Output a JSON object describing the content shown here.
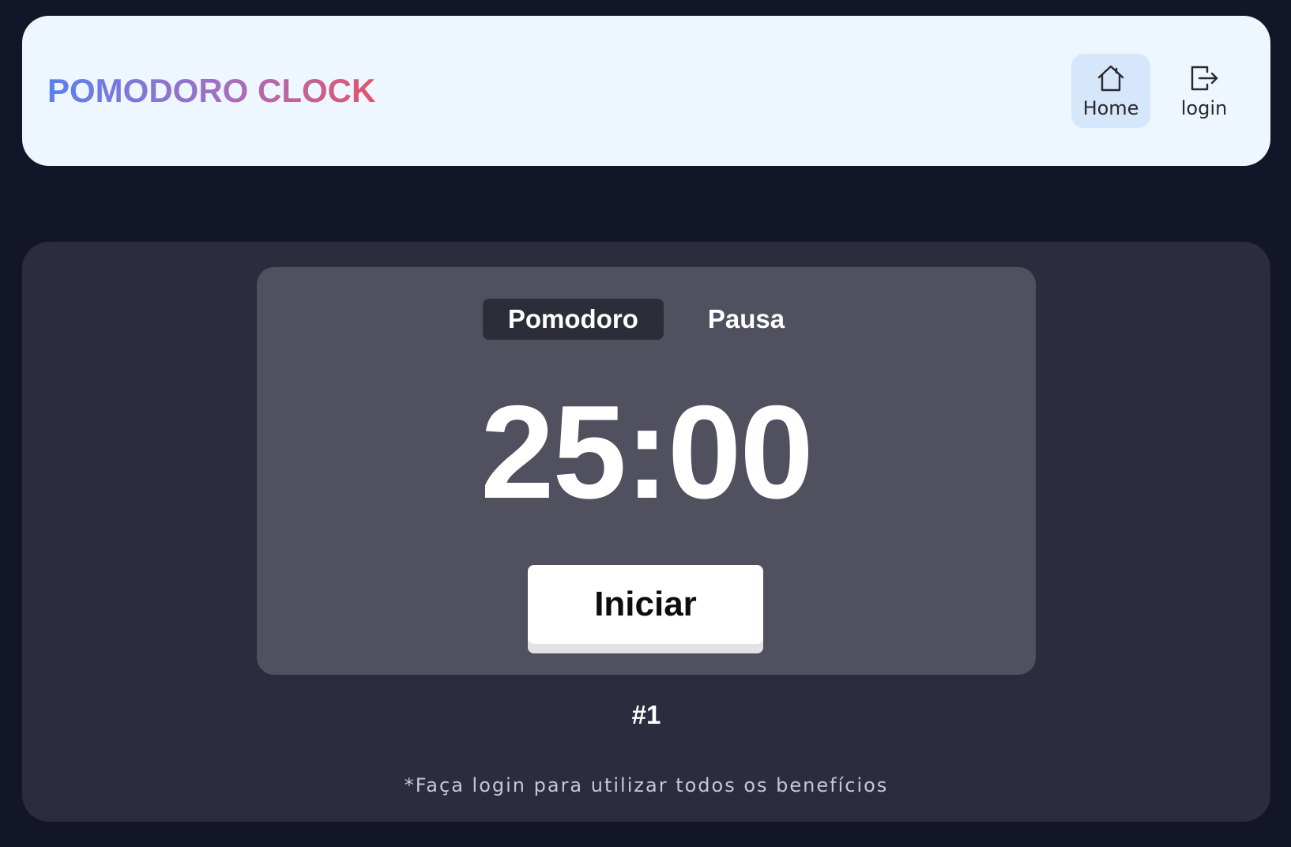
{
  "header": {
    "logo_text": "POMODORO CLOCK",
    "nav": {
      "home_label": "Home",
      "login_label": "login"
    }
  },
  "timer": {
    "tabs": {
      "pomodoro_label": "Pomodoro",
      "pausa_label": "Pausa"
    },
    "time": "25:00",
    "start_label": "Iniciar"
  },
  "counter": "#1",
  "note": "*Faça login para utilizar todos os benefícios",
  "colors": {
    "page_background": "#131628",
    "header_background": "#eef6ff",
    "nav_active_background": "#d6e6fb",
    "panel_background": "#2b2c3d",
    "card_background": "#51505f",
    "tab_active_background": "#2d2d3a",
    "logo_gradient": [
      "#5b7ff0",
      "#a56fc0",
      "#e0566a"
    ]
  },
  "icons": {
    "home": "home-icon",
    "login": "login-icon"
  }
}
